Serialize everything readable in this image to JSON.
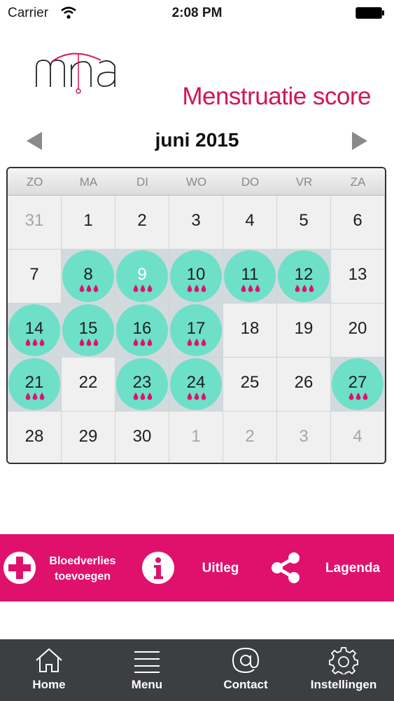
{
  "status_bar": {
    "carrier": "Carrier",
    "time": "2:08 PM"
  },
  "header": {
    "logo_text": "mra",
    "title": "Menstruatie score"
  },
  "calendar": {
    "month": "juni 2015",
    "weekdays": [
      "ZO",
      "MA",
      "DI",
      "WO",
      "DO",
      "VR",
      "ZA"
    ],
    "days": [
      {
        "label": "31",
        "other": true
      },
      {
        "label": "1"
      },
      {
        "label": "2"
      },
      {
        "label": "3"
      },
      {
        "label": "4"
      },
      {
        "label": "5"
      },
      {
        "label": "6"
      },
      {
        "label": "7"
      },
      {
        "label": "8",
        "period": true
      },
      {
        "label": "9",
        "period": true,
        "today": true
      },
      {
        "label": "10",
        "period": true
      },
      {
        "label": "11",
        "period": true
      },
      {
        "label": "12",
        "period": true
      },
      {
        "label": "13"
      },
      {
        "label": "14",
        "period": true
      },
      {
        "label": "15",
        "period": true
      },
      {
        "label": "16",
        "period": true
      },
      {
        "label": "17",
        "period": true
      },
      {
        "label": "18"
      },
      {
        "label": "19"
      },
      {
        "label": "20"
      },
      {
        "label": "21",
        "period": true
      },
      {
        "label": "22"
      },
      {
        "label": "23",
        "period": true
      },
      {
        "label": "24",
        "period": true
      },
      {
        "label": "25"
      },
      {
        "label": "26"
      },
      {
        "label": "27",
        "period": true
      },
      {
        "label": "28"
      },
      {
        "label": "29"
      },
      {
        "label": "30"
      },
      {
        "label": "1",
        "other": true
      },
      {
        "label": "2",
        "other": true
      },
      {
        "label": "3",
        "other": true
      },
      {
        "label": "4",
        "other": true
      }
    ],
    "period_color": "#6ee0c8",
    "drop_color": "#e0116c"
  },
  "actions": {
    "add_blood_loss_line1": "Bloedverlies",
    "add_blood_loss_line2": "toevoegen",
    "explanation": "Uitleg",
    "legend": "Lagenda"
  },
  "tabbar": {
    "home": "Home",
    "menu": "Menu",
    "contact": "Contact",
    "settings": "Instellingen"
  },
  "colors": {
    "accent": "#d2145a",
    "action_bar": "#e0116c",
    "tabbar": "#3c3e42"
  }
}
